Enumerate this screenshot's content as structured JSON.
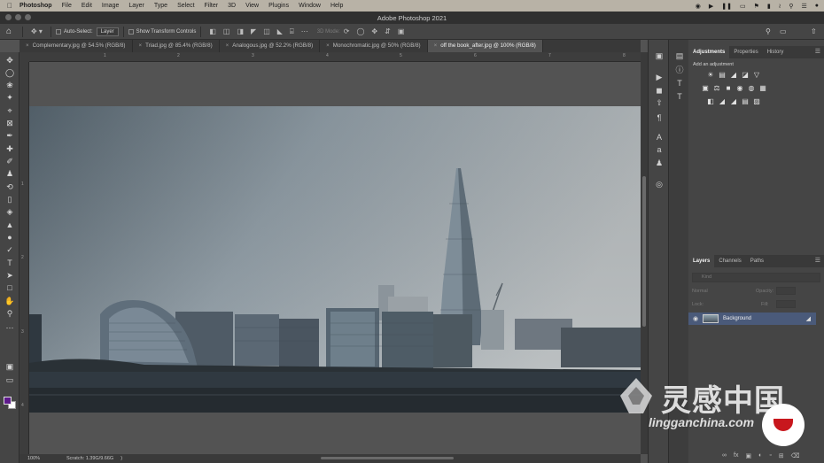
{
  "menubar": {
    "app_name": "Photoshop",
    "items": [
      "File",
      "Edit",
      "Image",
      "Layer",
      "Type",
      "Select",
      "Filter",
      "3D",
      "View",
      "Plugins",
      "Window",
      "Help"
    ]
  },
  "window": {
    "title": "Adobe Photoshop 2021"
  },
  "options": {
    "auto_select_label": "Auto-Select:",
    "auto_select_value": "Layer",
    "show_transform_label": "Show Transform Controls",
    "mode_3d_label": "3D Mode:"
  },
  "tabs": [
    {
      "label": "Complementary.jpg @ 54.5% (RGB/8)"
    },
    {
      "label": "Triad.jpg @ 85.4% (RGB/8)"
    },
    {
      "label": "Analogous.jpg @ 52.2% (RGB/8)"
    },
    {
      "label": "Monochromatic.jpg @ 50% (RGB/8)"
    },
    {
      "label": "off the book_after.jpg @ 100% (RGB/8)"
    }
  ],
  "ruler_top_ticks": [
    "1",
    "2",
    "3",
    "4",
    "5",
    "6",
    "7",
    "8"
  ],
  "ruler_left_ticks": [
    "1",
    "2",
    "3",
    "4"
  ],
  "status": {
    "zoom": "100%",
    "scratch": "Scratch: 1.39G/9.66G",
    "arrow": ")"
  },
  "adjustments_panel": {
    "tabs": [
      "Adjustments",
      "Properties",
      "History"
    ],
    "add_label": "Add an adjustment"
  },
  "layers_panel": {
    "tabs": [
      "Layers",
      "Channels",
      "Paths"
    ],
    "search_placeholder": "Kind",
    "blend_mode": "Normal",
    "opacity_label": "Opacity:",
    "lock_label": "Lock:",
    "fill_label": "Fill:",
    "layer_name": "Background"
  },
  "watermark": {
    "chinese": "灵感中国",
    "english": "lingganchina.com"
  },
  "colors": {
    "foreground": "#5e1a8c",
    "background": "#ffffff",
    "selected_layer": "#4a5a7a"
  }
}
